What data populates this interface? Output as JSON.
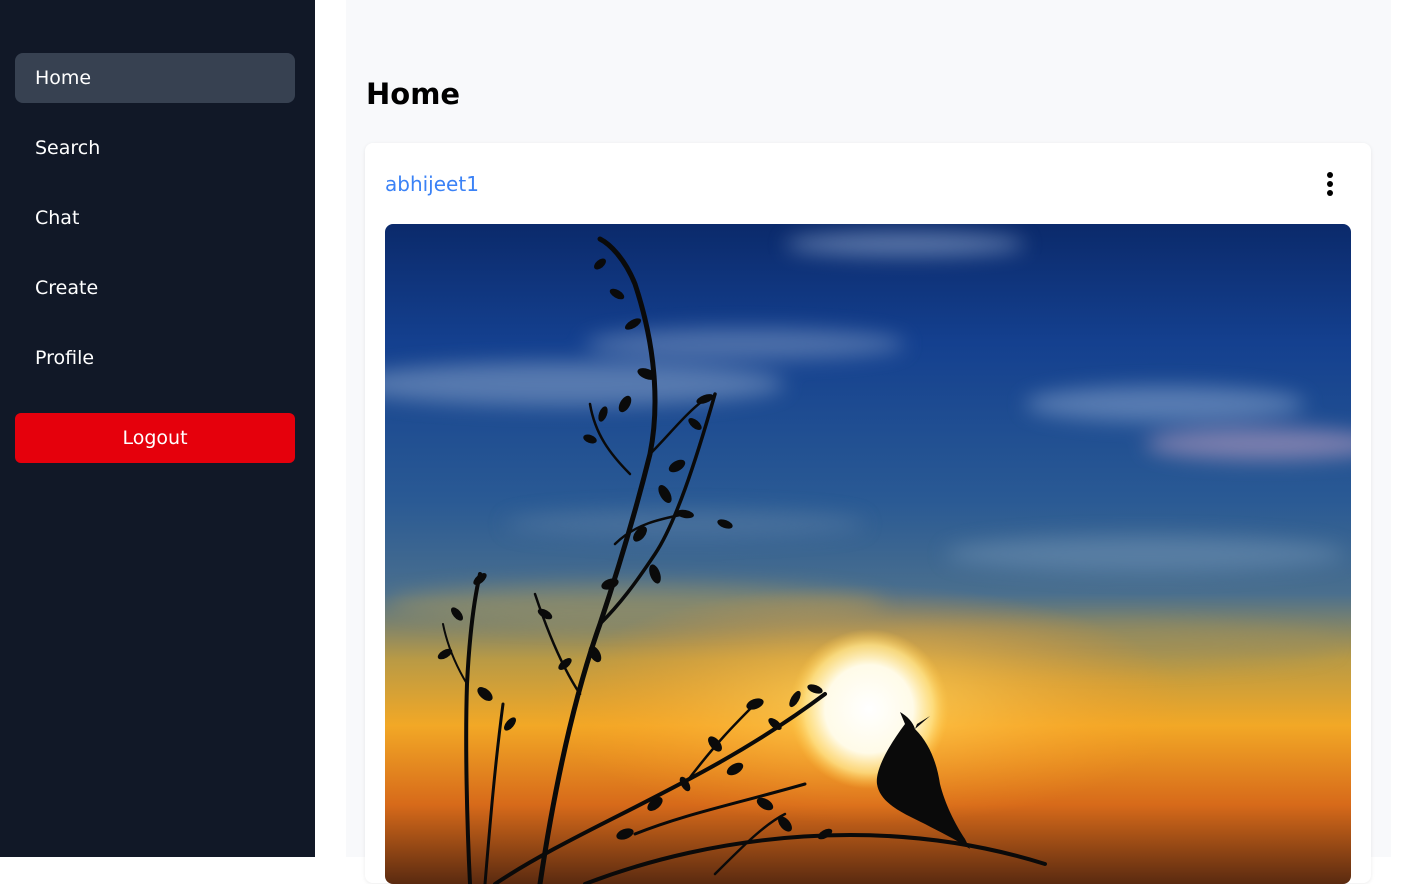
{
  "sidebar": {
    "items": [
      {
        "label": "Home",
        "active": true
      },
      {
        "label": "Search",
        "active": false
      },
      {
        "label": "Chat",
        "active": false
      },
      {
        "label": "Create",
        "active": false
      },
      {
        "label": "Profile",
        "active": false
      }
    ],
    "logout_label": "Logout",
    "colors": {
      "background": "#111827",
      "active_item": "#374151",
      "logout": "#e5000c"
    }
  },
  "main": {
    "title": "Home",
    "post": {
      "username": "abhijeet1",
      "username_color": "#3b82f6",
      "menu_icon": "more-vertical-icon",
      "image_description_icon": "photo"
    }
  }
}
